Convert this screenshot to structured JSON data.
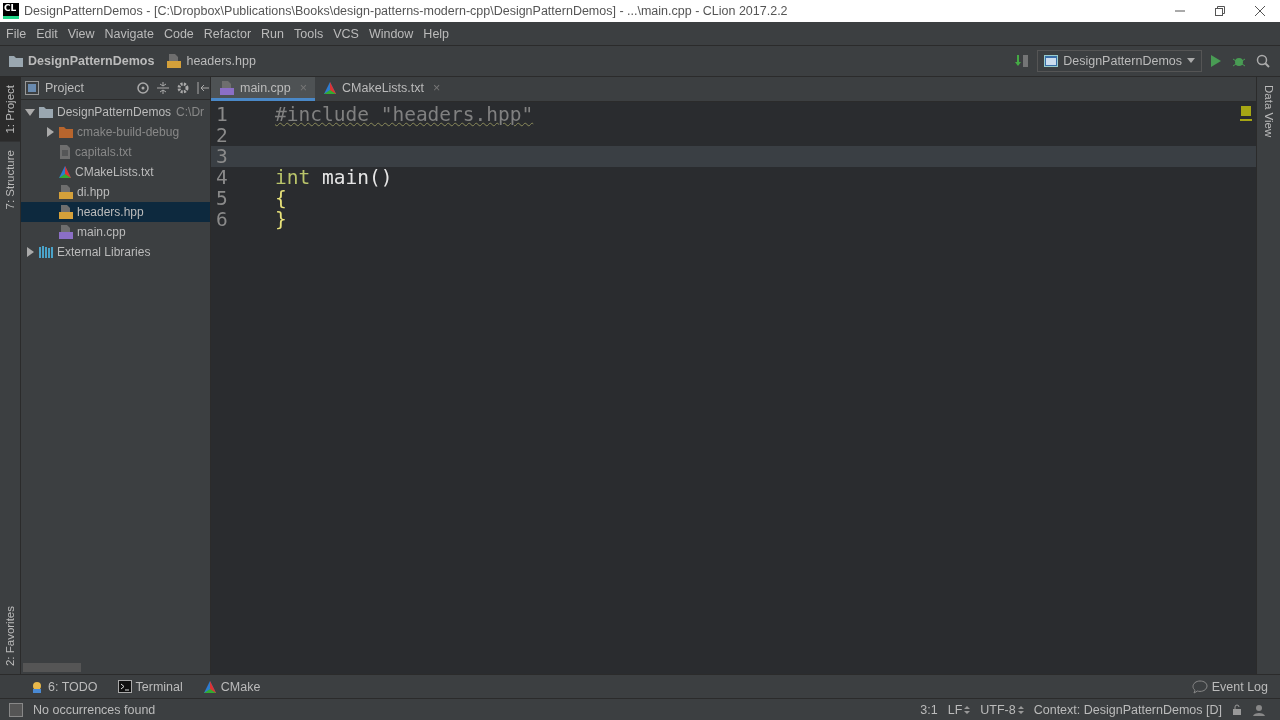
{
  "window": {
    "title": "DesignPatternDemos - [C:\\Dropbox\\Publications\\Books\\design-patterns-modern-cpp\\DesignPatternDemos] - ...\\main.cpp - CLion 2017.2.2",
    "app_badge": "CL"
  },
  "menu": [
    "File",
    "Edit",
    "View",
    "Navigate",
    "Code",
    "Refactor",
    "Run",
    "Tools",
    "VCS",
    "Window",
    "Help"
  ],
  "breadcrumbs": [
    {
      "kind": "folder",
      "label": "DesignPatternDemos"
    },
    {
      "kind": "header",
      "label": "headers.hpp"
    }
  ],
  "run_config": {
    "label": "DesignPatternDemos"
  },
  "left_strip": [
    {
      "label": "1: Project",
      "selected": true
    },
    {
      "label": "7: Structure",
      "selected": false
    }
  ],
  "left_strip_bottom": [
    {
      "label": "2: Favorites",
      "selected": false
    }
  ],
  "right_strip": [
    {
      "label": "Data View",
      "selected": false
    }
  ],
  "project": {
    "title": "Project",
    "tree": [
      {
        "kind": "folder",
        "label": "DesignPatternDemos",
        "hint": "C:\\Dr",
        "expanded": true,
        "selected": false,
        "dimmed": false,
        "children": [
          {
            "kind": "excluded",
            "label": "cmake-build-debug",
            "expanded": false,
            "selected": false,
            "dimmed": true
          },
          {
            "kind": "text",
            "label": "capitals.txt",
            "selected": false,
            "dimmed": true
          },
          {
            "kind": "cmake",
            "label": "CMakeLists.txt",
            "selected": false,
            "dimmed": false
          },
          {
            "kind": "header",
            "label": "di.hpp",
            "selected": false,
            "dimmed": false
          },
          {
            "kind": "header",
            "label": "headers.hpp",
            "selected": true,
            "dimmed": false
          },
          {
            "kind": "cpp",
            "label": "main.cpp",
            "selected": false,
            "dimmed": false
          }
        ]
      },
      {
        "kind": "libraries",
        "label": "External Libraries",
        "expanded": false,
        "selected": false,
        "dimmed": false
      }
    ]
  },
  "editor_tabs": [
    {
      "kind": "cpp",
      "label": "main.cpp",
      "close": "×",
      "selected": true
    },
    {
      "kind": "cmake",
      "label": "CMakeLists.txt",
      "close": "×",
      "selected": false
    }
  ],
  "editor": {
    "lines": [
      {
        "number": "1",
        "current": false,
        "tokens": [
          {
            "kind": "unused",
            "text": "#include \"headers.hpp\""
          }
        ]
      },
      {
        "number": "2",
        "current": false
      },
      {
        "number": "3",
        "current": true
      },
      {
        "number": "4",
        "current": false,
        "tokens": [
          {
            "kind": "keyword",
            "text": "int"
          },
          {
            "kind": "plain",
            "text": " main()"
          }
        ]
      },
      {
        "number": "5",
        "current": false,
        "tokens": [
          {
            "kind": "brace",
            "text": "{"
          }
        ]
      },
      {
        "number": "6",
        "current": false,
        "tokens": [
          {
            "kind": "brace",
            "text": "}"
          }
        ]
      }
    ]
  },
  "tool_windows": [
    {
      "kind": "todo",
      "label": "6: TODO"
    },
    {
      "kind": "terminal",
      "label": "Terminal"
    },
    {
      "kind": "cmake",
      "label": "CMake"
    }
  ],
  "event_log": {
    "label": "Event Log"
  },
  "status_bar": {
    "message": "No occurrences found",
    "position": "3:1",
    "line_separator": "LF",
    "encoding": "UTF-8",
    "context": "Context: DesignPatternDemos [D]"
  }
}
